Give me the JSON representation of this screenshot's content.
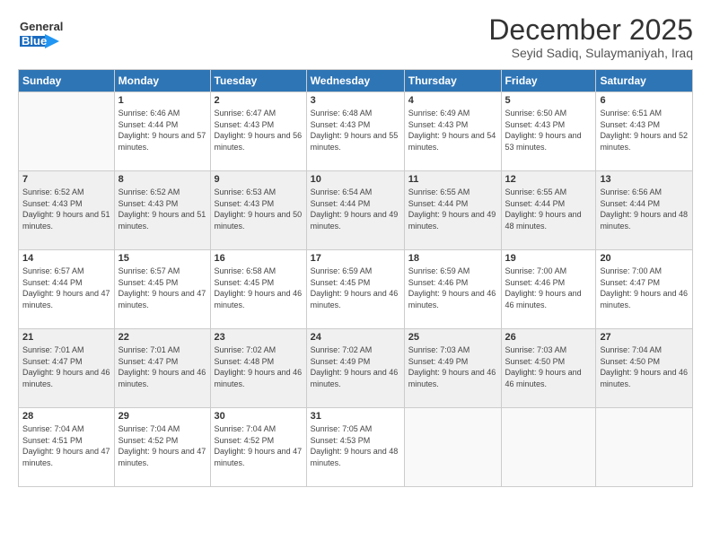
{
  "header": {
    "logo_general": "General",
    "logo_blue": "Blue",
    "month_title": "December 2025",
    "subtitle": "Seyid Sadiq, Sulaymaniyah, Iraq"
  },
  "weekdays": [
    "Sunday",
    "Monday",
    "Tuesday",
    "Wednesday",
    "Thursday",
    "Friday",
    "Saturday"
  ],
  "weeks": [
    [
      {
        "day": "",
        "sunrise": "",
        "sunset": "",
        "daylight": ""
      },
      {
        "day": "1",
        "sunrise": "Sunrise: 6:46 AM",
        "sunset": "Sunset: 4:44 PM",
        "daylight": "Daylight: 9 hours and 57 minutes."
      },
      {
        "day": "2",
        "sunrise": "Sunrise: 6:47 AM",
        "sunset": "Sunset: 4:43 PM",
        "daylight": "Daylight: 9 hours and 56 minutes."
      },
      {
        "day": "3",
        "sunrise": "Sunrise: 6:48 AM",
        "sunset": "Sunset: 4:43 PM",
        "daylight": "Daylight: 9 hours and 55 minutes."
      },
      {
        "day": "4",
        "sunrise": "Sunrise: 6:49 AM",
        "sunset": "Sunset: 4:43 PM",
        "daylight": "Daylight: 9 hours and 54 minutes."
      },
      {
        "day": "5",
        "sunrise": "Sunrise: 6:50 AM",
        "sunset": "Sunset: 4:43 PM",
        "daylight": "Daylight: 9 hours and 53 minutes."
      },
      {
        "day": "6",
        "sunrise": "Sunrise: 6:51 AM",
        "sunset": "Sunset: 4:43 PM",
        "daylight": "Daylight: 9 hours and 52 minutes."
      }
    ],
    [
      {
        "day": "7",
        "sunrise": "Sunrise: 6:52 AM",
        "sunset": "Sunset: 4:43 PM",
        "daylight": "Daylight: 9 hours and 51 minutes."
      },
      {
        "day": "8",
        "sunrise": "Sunrise: 6:52 AM",
        "sunset": "Sunset: 4:43 PM",
        "daylight": "Daylight: 9 hours and 51 minutes."
      },
      {
        "day": "9",
        "sunrise": "Sunrise: 6:53 AM",
        "sunset": "Sunset: 4:43 PM",
        "daylight": "Daylight: 9 hours and 50 minutes."
      },
      {
        "day": "10",
        "sunrise": "Sunrise: 6:54 AM",
        "sunset": "Sunset: 4:44 PM",
        "daylight": "Daylight: 9 hours and 49 minutes."
      },
      {
        "day": "11",
        "sunrise": "Sunrise: 6:55 AM",
        "sunset": "Sunset: 4:44 PM",
        "daylight": "Daylight: 9 hours and 49 minutes."
      },
      {
        "day": "12",
        "sunrise": "Sunrise: 6:55 AM",
        "sunset": "Sunset: 4:44 PM",
        "daylight": "Daylight: 9 hours and 48 minutes."
      },
      {
        "day": "13",
        "sunrise": "Sunrise: 6:56 AM",
        "sunset": "Sunset: 4:44 PM",
        "daylight": "Daylight: 9 hours and 48 minutes."
      }
    ],
    [
      {
        "day": "14",
        "sunrise": "Sunrise: 6:57 AM",
        "sunset": "Sunset: 4:44 PM",
        "daylight": "Daylight: 9 hours and 47 minutes."
      },
      {
        "day": "15",
        "sunrise": "Sunrise: 6:57 AM",
        "sunset": "Sunset: 4:45 PM",
        "daylight": "Daylight: 9 hours and 47 minutes."
      },
      {
        "day": "16",
        "sunrise": "Sunrise: 6:58 AM",
        "sunset": "Sunset: 4:45 PM",
        "daylight": "Daylight: 9 hours and 46 minutes."
      },
      {
        "day": "17",
        "sunrise": "Sunrise: 6:59 AM",
        "sunset": "Sunset: 4:45 PM",
        "daylight": "Daylight: 9 hours and 46 minutes."
      },
      {
        "day": "18",
        "sunrise": "Sunrise: 6:59 AM",
        "sunset": "Sunset: 4:46 PM",
        "daylight": "Daylight: 9 hours and 46 minutes."
      },
      {
        "day": "19",
        "sunrise": "Sunrise: 7:00 AM",
        "sunset": "Sunset: 4:46 PM",
        "daylight": "Daylight: 9 hours and 46 minutes."
      },
      {
        "day": "20",
        "sunrise": "Sunrise: 7:00 AM",
        "sunset": "Sunset: 4:47 PM",
        "daylight": "Daylight: 9 hours and 46 minutes."
      }
    ],
    [
      {
        "day": "21",
        "sunrise": "Sunrise: 7:01 AM",
        "sunset": "Sunset: 4:47 PM",
        "daylight": "Daylight: 9 hours and 46 minutes."
      },
      {
        "day": "22",
        "sunrise": "Sunrise: 7:01 AM",
        "sunset": "Sunset: 4:47 PM",
        "daylight": "Daylight: 9 hours and 46 minutes."
      },
      {
        "day": "23",
        "sunrise": "Sunrise: 7:02 AM",
        "sunset": "Sunset: 4:48 PM",
        "daylight": "Daylight: 9 hours and 46 minutes."
      },
      {
        "day": "24",
        "sunrise": "Sunrise: 7:02 AM",
        "sunset": "Sunset: 4:49 PM",
        "daylight": "Daylight: 9 hours and 46 minutes."
      },
      {
        "day": "25",
        "sunrise": "Sunrise: 7:03 AM",
        "sunset": "Sunset: 4:49 PM",
        "daylight": "Daylight: 9 hours and 46 minutes."
      },
      {
        "day": "26",
        "sunrise": "Sunrise: 7:03 AM",
        "sunset": "Sunset: 4:50 PM",
        "daylight": "Daylight: 9 hours and 46 minutes."
      },
      {
        "day": "27",
        "sunrise": "Sunrise: 7:04 AM",
        "sunset": "Sunset: 4:50 PM",
        "daylight": "Daylight: 9 hours and 46 minutes."
      }
    ],
    [
      {
        "day": "28",
        "sunrise": "Sunrise: 7:04 AM",
        "sunset": "Sunset: 4:51 PM",
        "daylight": "Daylight: 9 hours and 47 minutes."
      },
      {
        "day": "29",
        "sunrise": "Sunrise: 7:04 AM",
        "sunset": "Sunset: 4:52 PM",
        "daylight": "Daylight: 9 hours and 47 minutes."
      },
      {
        "day": "30",
        "sunrise": "Sunrise: 7:04 AM",
        "sunset": "Sunset: 4:52 PM",
        "daylight": "Daylight: 9 hours and 47 minutes."
      },
      {
        "day": "31",
        "sunrise": "Sunrise: 7:05 AM",
        "sunset": "Sunset: 4:53 PM",
        "daylight": "Daylight: 9 hours and 48 minutes."
      },
      {
        "day": "",
        "sunrise": "",
        "sunset": "",
        "daylight": ""
      },
      {
        "day": "",
        "sunrise": "",
        "sunset": "",
        "daylight": ""
      },
      {
        "day": "",
        "sunrise": "",
        "sunset": "",
        "daylight": ""
      }
    ]
  ]
}
